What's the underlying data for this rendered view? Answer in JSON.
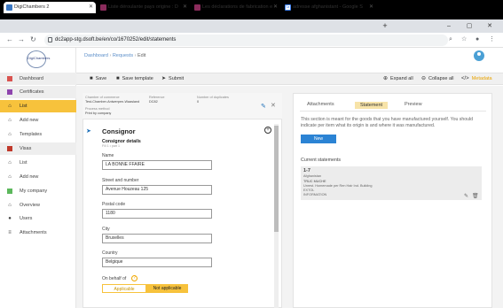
{
  "browser": {
    "tabs": [
      {
        "label": "DigiChambers 2",
        "color": "#3b78c4"
      },
      {
        "label": "Liste déroulante pays origine : D",
        "color": "#8b2c5c"
      },
      {
        "label": "Les déclarations de fabrication e",
        "color": "#8b2c5c"
      },
      {
        "label": "adresse afghanistant - Google S",
        "color": "#4285f4"
      }
    ],
    "new_tab": "+",
    "url": "dc2app-stg.dsoft.be/en/co/1670252/edit/statements",
    "window_controls": [
      "–",
      "▢",
      "✕"
    ]
  },
  "sidebar": {
    "logo": "DigiChambers",
    "items": [
      {
        "label": "Dashboard",
        "icon": "dashboard-icon"
      },
      {
        "label": "Certificates",
        "icon": "certificate-icon"
      },
      {
        "label": "List",
        "icon": "home-icon"
      },
      {
        "label": "Add new",
        "icon": "home-icon"
      },
      {
        "label": "Templates",
        "icon": "home-icon"
      },
      {
        "label": "Visas",
        "icon": "visa-icon"
      },
      {
        "label": "List",
        "icon": "home-icon"
      },
      {
        "label": "Add new",
        "icon": "home-icon"
      },
      {
        "label": "My company",
        "icon": "company-icon"
      },
      {
        "label": "Overview",
        "icon": "home-icon"
      },
      {
        "label": "Users",
        "icon": "users-icon"
      },
      {
        "label": "Attachments",
        "icon": "attachment-icon"
      }
    ]
  },
  "breadcrumb": {
    "items": [
      "Dashboard",
      "Requests",
      ""
    ],
    "current": "Edit"
  },
  "toolbar": {
    "save": "Save",
    "save_template": "Save template",
    "submit": "Submit",
    "expand_all": "Expand all",
    "collapse_all": "Collapse all",
    "metadata": "Metadata"
  },
  "info": {
    "chamber_label": "Chamber of commerce",
    "chamber_value": "Test-Chamber-Antwerpen-Waasland",
    "reference_label": "Reference",
    "reference_value": "DC82",
    "supplicates_label": "Number of duplicates",
    "supplicates_value": "0",
    "process_label": "Process method",
    "process_value": "Print by company"
  },
  "consignor": {
    "title": "Consignor",
    "details_title": "Consignor details",
    "small_note": "Fill 1 • part 1",
    "fields": [
      {
        "label": "Name",
        "value": "LA BONNE FFAIRE"
      },
      {
        "label": "Street and number",
        "value": "Avenue Houzeau 125"
      },
      {
        "label": "Postal code",
        "value": "1180"
      },
      {
        "label": "City",
        "value": "Bruxelles"
      },
      {
        "label": "Country",
        "value": "Belgique"
      }
    ],
    "on_behalf_label": "On behalf of",
    "toggle_off": "Applicable",
    "toggle_on": "Not applicable"
  },
  "right_panel": {
    "tabs": [
      "Attachments",
      "Statement",
      "Preview"
    ],
    "description": "This section is meant for the goods that you have manufactured yourself. You should indicate per item what its origin is and where it was manufactured.",
    "new_button": "New",
    "current_statements_label": "Current statements",
    "statement": {
      "title": "1-7",
      "line1": "Afghanistan",
      "line2": "TRUC MUCHE",
      "line3": "Unrest. Homemade per Ren Hair Ind. Building",
      "line4": "EXTOL",
      "line5": "INFORMATION"
    }
  }
}
